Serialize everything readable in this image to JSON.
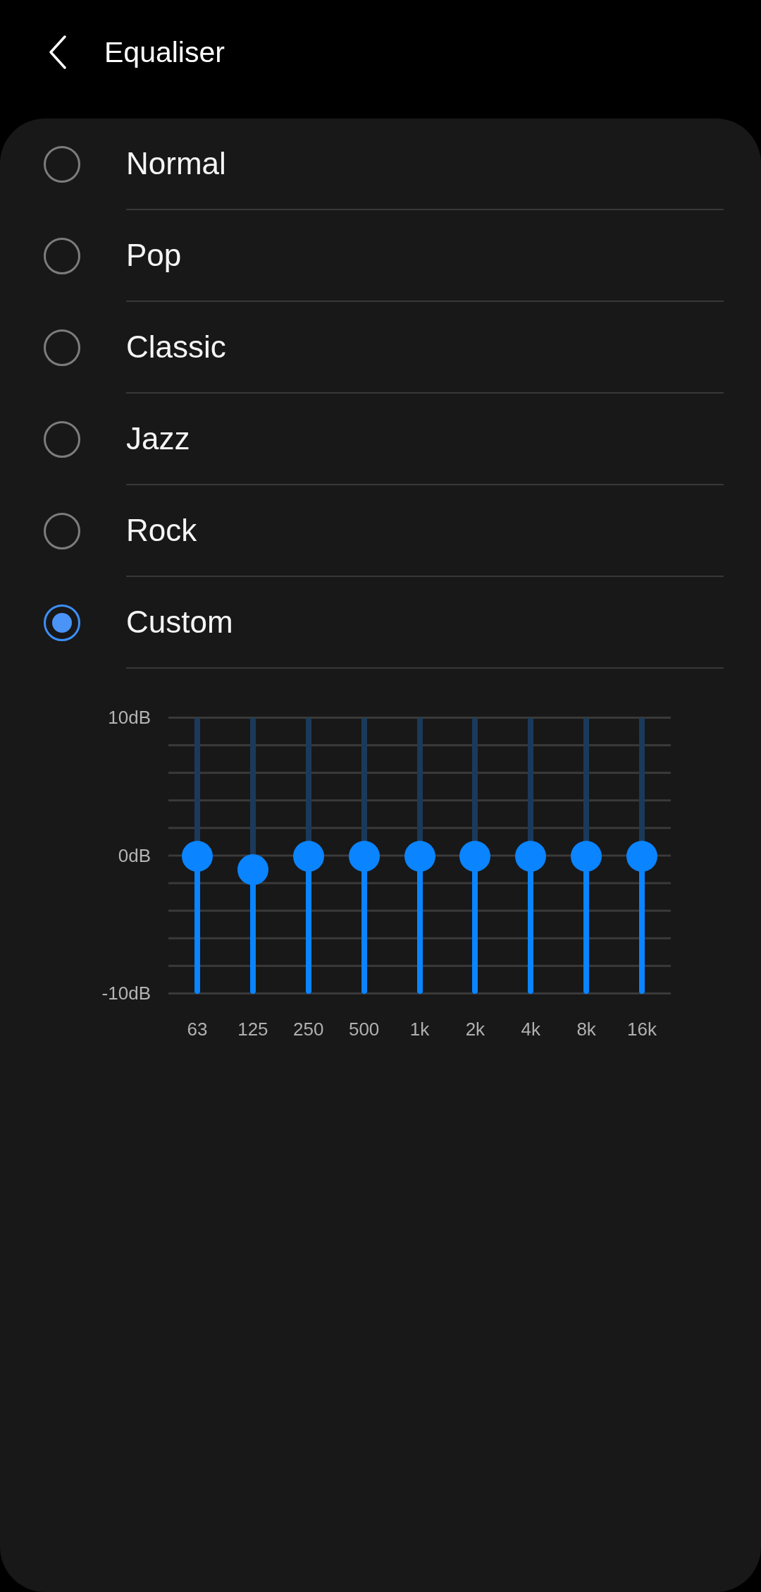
{
  "header": {
    "title": "Equaliser"
  },
  "presets": [
    {
      "label": "Normal",
      "selected": false
    },
    {
      "label": "Pop",
      "selected": false
    },
    {
      "label": "Classic",
      "selected": false
    },
    {
      "label": "Jazz",
      "selected": false
    },
    {
      "label": "Rock",
      "selected": false
    },
    {
      "label": "Custom",
      "selected": true
    }
  ],
  "equalizer": {
    "scale_labels": [
      "10dB",
      "0dB",
      "-10dB"
    ],
    "bands": [
      {
        "label": "63",
        "level": 0.5
      },
      {
        "label": "125",
        "level": 0.45
      },
      {
        "label": "250",
        "level": 0.5
      },
      {
        "label": "500",
        "level": 0.5
      },
      {
        "label": "1k",
        "level": 0.5
      },
      {
        "label": "2k",
        "level": 0.5
      },
      {
        "label": "4k",
        "level": 0.5
      },
      {
        "label": "8k",
        "level": 0.5
      },
      {
        "label": "16k",
        "level": 0.5
      }
    ]
  }
}
